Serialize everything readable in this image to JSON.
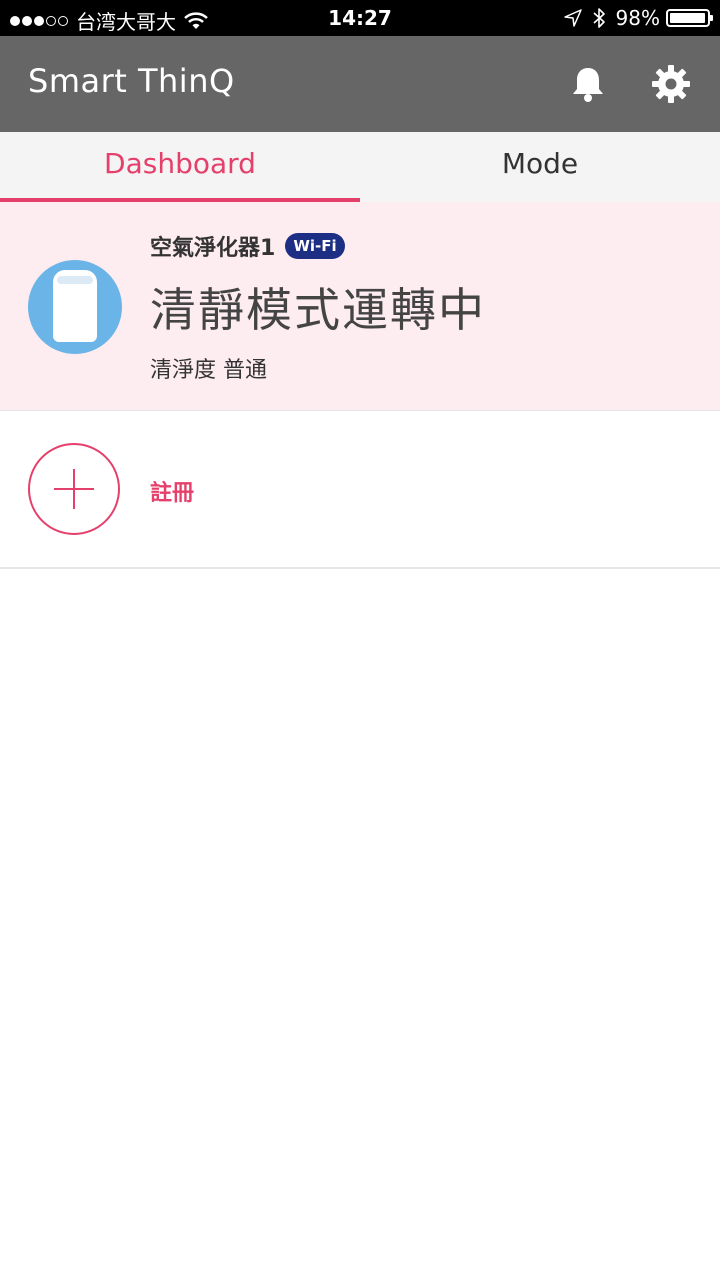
{
  "status_bar": {
    "carrier": "台湾大哥大",
    "time": "14:27",
    "battery": "98%",
    "battery_level": 0.98,
    "icons": [
      "signal-dots-icon",
      "wifi-icon",
      "location-arrow-icon",
      "bluetooth-icon",
      "battery-icon"
    ]
  },
  "app_bar": {
    "title": "Smart ThinQ",
    "icons": [
      "bell-icon",
      "gear-icon"
    ]
  },
  "tabs": [
    {
      "label": "Dashboard",
      "active": true
    },
    {
      "label": "Mode",
      "active": false
    }
  ],
  "device": {
    "name": "空氣淨化器1",
    "badge": "Wi-Fi",
    "status": "清靜模式運轉中",
    "sub": "清淨度 普通",
    "icon": "air-purifier-icon"
  },
  "register": {
    "label": "註冊",
    "icon": "plus-icon"
  },
  "colors": {
    "accent": "#e5406c",
    "app_bar": "#666666",
    "device_card_bg": "#fdecf0",
    "wifi_badge": "#1d2f84",
    "device_icon_bg": "#6ab4e8"
  }
}
